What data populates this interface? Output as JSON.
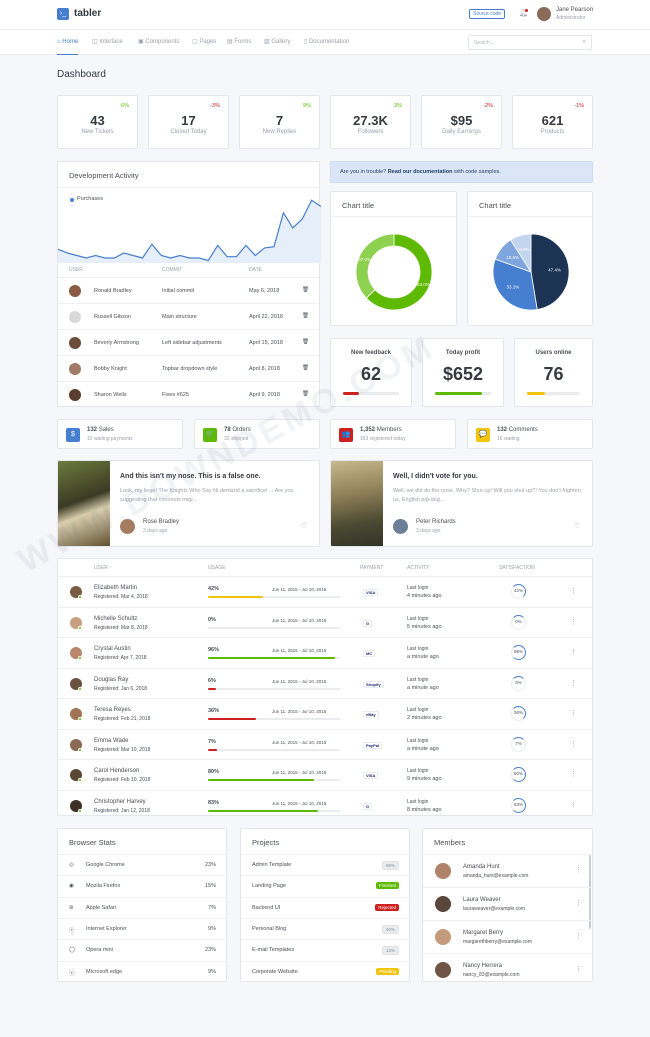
{
  "brand": {
    "name": "tabler"
  },
  "header": {
    "source_code": "Source code",
    "user_name": "Jane Pearson",
    "user_role": "Administrator"
  },
  "nav": {
    "items": [
      "Home",
      "Interface",
      "Components",
      "Pages",
      "Forms",
      "Gallery",
      "Documentation"
    ],
    "search_placeholder": "Search…"
  },
  "page_title": "Dashboard",
  "stats": [
    {
      "value": "43",
      "label": "New Tickets",
      "change": "6%",
      "dir": "up"
    },
    {
      "value": "17",
      "label": "Closed Today",
      "change": "-3%",
      "dir": "down"
    },
    {
      "value": "7",
      "label": "New Replies",
      "change": "9%",
      "dir": "up"
    },
    {
      "value": "27.3K",
      "label": "Followers",
      "change": "3%",
      "dir": "up"
    },
    {
      "value": "$95",
      "label": "Daily Earnings",
      "change": "-2%",
      "dir": "down"
    },
    {
      "value": "621",
      "label": "Products",
      "change": "-1%",
      "dir": "down"
    }
  ],
  "dev": {
    "title": "Development Activity",
    "legend": "Purchases",
    "chart_data": {
      "type": "area",
      "series": [
        {
          "name": "Purchases",
          "values": [
            11,
            8,
            6,
            4,
            6,
            4,
            4,
            8,
            6,
            4,
            15,
            6,
            4,
            6,
            4,
            4,
            2,
            14,
            5,
            5,
            14,
            6,
            12,
            13,
            40,
            28,
            35,
            50,
            45
          ]
        }
      ]
    },
    "cols": [
      "User",
      "Commit",
      "Date"
    ],
    "rows": [
      {
        "user": "Ronald Bradley",
        "commit": "Initial commit",
        "date": "May 6, 2018"
      },
      {
        "user": "Russell Gibson",
        "commit": "Main structure",
        "date": "April 22, 2018"
      },
      {
        "user": "Beverly Armstrong",
        "commit": "Left sidebar adjustments",
        "date": "April 15, 2018"
      },
      {
        "user": "Bobby Knight",
        "commit": "Topbar dropdown style",
        "date": "April 8, 2018"
      },
      {
        "user": "Sharon Wells",
        "commit": "Fixes #625",
        "date": "April 9, 2018"
      }
    ]
  },
  "alert": {
    "prefix": "Are you in trouble?",
    "link": "Read our documentation",
    "suffix": "with code samples."
  },
  "donut": {
    "title": "Chart title",
    "chart_data": {
      "type": "pie",
      "values": [
        63,
        37
      ],
      "labels": [
        "63.0%",
        "37.0%"
      ],
      "colors": [
        "#5eba00",
        "#8ed04f"
      ]
    }
  },
  "pie": {
    "title": "Chart title",
    "chart_data": {
      "type": "pie",
      "values": [
        47.4,
        33.1,
        10.5,
        9.0
      ],
      "labels": [
        "47.4%",
        "33.1%",
        "10.5%",
        "9.0%"
      ],
      "colors": [
        "#1c3353",
        "#467fcf",
        "#7ea5dd",
        "#c3d4ee"
      ]
    }
  },
  "mini": [
    {
      "title": "New feedback",
      "value": "62",
      "pct": 0.28,
      "color": "#cd201f"
    },
    {
      "title": "Today profit",
      "value": "$652",
      "pct": 0.84,
      "color": "#5eba00"
    },
    {
      "title": "Users online",
      "value": "76",
      "pct": 0.34,
      "color": "#f1c40f"
    }
  ],
  "small_stats": [
    {
      "num": "132",
      "word": "Sales",
      "sub": "12 waiting payments",
      "color": "#467fcf",
      "icon": "$"
    },
    {
      "num": "78",
      "word": "Orders",
      "sub": "32 shipped",
      "color": "#5eba00",
      "icon": "🛒"
    },
    {
      "num": "1,352",
      "word": "Members",
      "sub": "163 registered today",
      "color": "#cd201f",
      "icon": "👥"
    },
    {
      "num": "132",
      "word": "Comments",
      "sub": "16 waiting",
      "color": "#f1c40f",
      "icon": "💬"
    }
  ],
  "posts": [
    {
      "title": "And this isn't my nose. This is a false one.",
      "body": "Look, my liege! The Knights Who Say Ni demand a sacrifice! …Are you suggesting that coconuts migr...",
      "author": "Rose Bradley",
      "time": "3 days ago"
    },
    {
      "title": "Well, I didn't vote for you.",
      "body": "Well, we did do the nose. Why? Shut up! Will you shut up?! You don't frighten us, English pig-dog...",
      "author": "Peter Richards",
      "time": "3 days ago"
    }
  ],
  "users_table": {
    "cols": [
      "User",
      "Usage",
      "Payment",
      "Activity",
      "Satisfaction"
    ],
    "range": "Jun 11, 2015 - Jul 10, 2015",
    "rows": [
      {
        "name": "Elizabeth Martin",
        "reg": "Registered: Mar 4, 2018",
        "usage": "42%",
        "pct": 0.42,
        "color": "#f1c40f",
        "pay": "VISA",
        "last": "4 minutes ago",
        "sat": "42%"
      },
      {
        "name": "Michelle Schultz",
        "reg": "Registered: Mar 8, 2018",
        "usage": "0%",
        "pct": 0,
        "color": "#cd201f",
        "pay": "G",
        "last": "5 minutes ago",
        "sat": "0%"
      },
      {
        "name": "Crystal Austin",
        "reg": "Registered: Apr 7, 2018",
        "usage": "96%",
        "pct": 0.96,
        "color": "#5eba00",
        "pay": "MC",
        "last": "a minute ago",
        "sat": "96%"
      },
      {
        "name": "Douglas Ray",
        "reg": "Registered: Jan 6, 2018",
        "usage": "6%",
        "pct": 0.06,
        "color": "#cd201f",
        "pay": "Shopify",
        "last": "a minute ago",
        "sat": "6%"
      },
      {
        "name": "Teresa Reyes",
        "reg": "Registered: Feb 21, 2018",
        "usage": "36%",
        "pct": 0.36,
        "color": "#cd201f",
        "pay": "eBay",
        "last": "2 minutes ago",
        "sat": "36%"
      },
      {
        "name": "Emma Wade",
        "reg": "Registered: Mar 10, 2018",
        "usage": "7%",
        "pct": 0.07,
        "color": "#cd201f",
        "pay": "PayPal",
        "last": "a minute ago",
        "sat": "7%"
      },
      {
        "name": "Carol Henderson",
        "reg": "Registered: Feb 10, 2018",
        "usage": "80%",
        "pct": 0.8,
        "color": "#5eba00",
        "pay": "VISA",
        "last": "9 minutes ago",
        "sat": "80%"
      },
      {
        "name": "Christopher Harvey",
        "reg": "Registered: Jan 12, 2018",
        "usage": "83%",
        "pct": 0.83,
        "color": "#5eba00",
        "pay": "G",
        "last": "8 minutes ago",
        "sat": "83%"
      }
    ],
    "last_login": "Last login"
  },
  "browser": {
    "title": "Browser Stats",
    "rows": [
      {
        "name": "Google Chrome",
        "pct": "23%"
      },
      {
        "name": "Mozila Firefox",
        "pct": "15%"
      },
      {
        "name": "Apple Safari",
        "pct": "7%"
      },
      {
        "name": "Internet Explorer",
        "pct": "9%"
      },
      {
        "name": "Opera mini",
        "pct": "23%"
      },
      {
        "name": "Microsoft edge",
        "pct": "9%"
      }
    ]
  },
  "projects": {
    "title": "Projects",
    "rows": [
      {
        "name": "Admin Template",
        "badge": "65%",
        "style": "gray"
      },
      {
        "name": "Landing Page",
        "badge": "Finished",
        "style": "green"
      },
      {
        "name": "Backend UI",
        "badge": "Rejected",
        "style": "red"
      },
      {
        "name": "Personal Blog",
        "badge": "40%",
        "style": "gray"
      },
      {
        "name": "E-mail Templates",
        "badge": "13%",
        "style": "gray"
      },
      {
        "name": "Corporate Website",
        "badge": "Pending",
        "style": "yellow"
      }
    ]
  },
  "members": {
    "title": "Members",
    "rows": [
      {
        "name": "Amanda Hunt",
        "email": "amanda_hunt@example.com"
      },
      {
        "name": "Laura Weaver",
        "email": "lauraweaver@example.com"
      },
      {
        "name": "Margaret Berry",
        "email": "margarethberry@example.com"
      },
      {
        "name": "Nancy Herrera",
        "email": "nancy_83@example.com"
      }
    ]
  },
  "watermark": "WWW.DOWNDEMO.COM"
}
